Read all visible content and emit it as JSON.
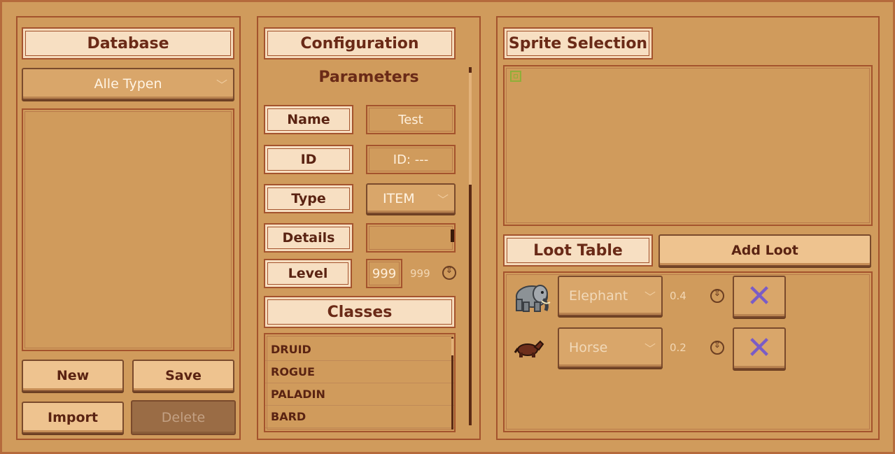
{
  "database": {
    "title": "Database",
    "type_filter": "Alle Typen",
    "buttons": {
      "new": "New",
      "save": "Save",
      "import": "Import",
      "delete": "Delete"
    }
  },
  "configuration": {
    "title": "Configuration",
    "parameters_title": "Parameters",
    "fields": {
      "name_label": "Name",
      "name_value": "Test",
      "id_label": "ID",
      "id_value": "ID: ---",
      "type_label": "Type",
      "type_value": "ITEM",
      "details_label": "Details",
      "details_value": "",
      "level_label": "Level",
      "level_value": "999",
      "level_max": "999"
    },
    "classes_title": "Classes",
    "classes": [
      "DRUID",
      "ROGUE",
      "PALADIN",
      "BARD"
    ]
  },
  "sprite": {
    "title": "Sprite Selection"
  },
  "loot": {
    "title": "Loot Table",
    "add_label": "Add Loot",
    "entries": [
      {
        "creature": "Elephant",
        "chance": "0.4",
        "icon": "elephant-icon"
      },
      {
        "creature": "Horse",
        "chance": "0.2",
        "icon": "horse-icon"
      }
    ],
    "remove_glyph": "✕"
  }
}
